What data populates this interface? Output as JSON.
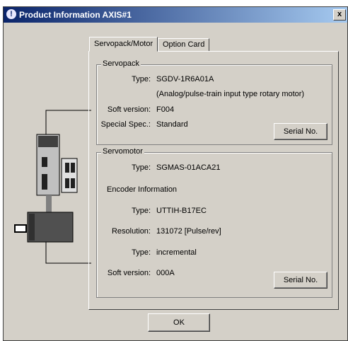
{
  "window": {
    "title": "Product Information AXIS#1",
    "close": "x"
  },
  "tabs": [
    {
      "label": "Servopack/Motor"
    },
    {
      "label": "Option Card"
    }
  ],
  "servopack": {
    "title": "Servopack",
    "type_label": "Type:",
    "type_value": "SGDV-1R6A01A",
    "type_desc": "(Analog/pulse-train input type rotary motor)",
    "soft_label": "Soft version:",
    "soft_value": "F004",
    "special_label": "Special Spec.:",
    "special_value": "Standard",
    "serial_button": "Serial No."
  },
  "servomotor": {
    "title": "Servomotor",
    "type_label": "Type:",
    "type_value": "SGMAS-01ACA21",
    "encoder_heading": "Encoder Information",
    "enc_type_label": "Type:",
    "enc_type_value": "UTTIH-B17EC",
    "resolution_label": "Resolution:",
    "resolution_value": "131072 [Pulse/rev]",
    "kind_label": "Type:",
    "kind_value": "incremental",
    "soft_label": "Soft version:",
    "soft_value": "000A",
    "serial_button": "Serial No."
  },
  "ok_button": "OK"
}
